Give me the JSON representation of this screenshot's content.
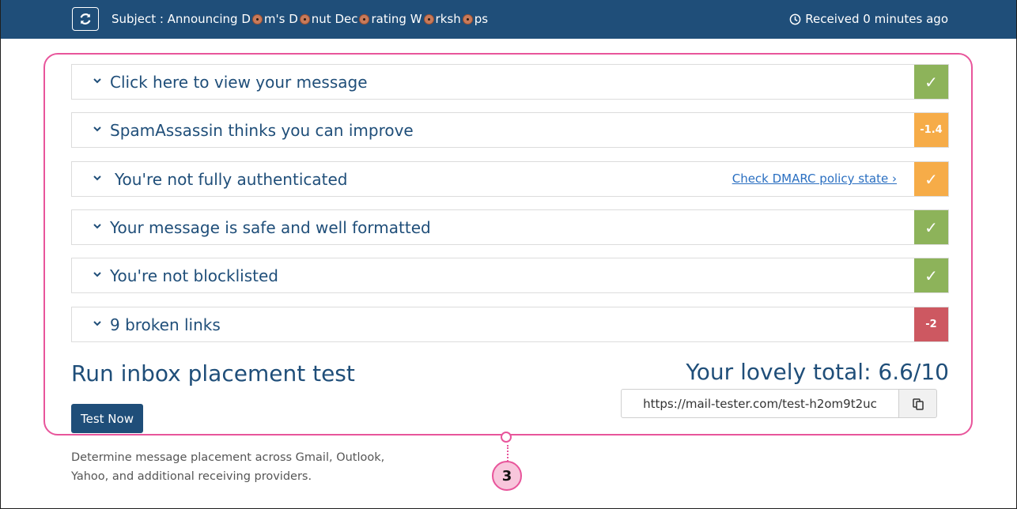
{
  "header": {
    "subject_parts": [
      "Subject : Announcing D",
      "m's D",
      "nut Dec",
      "rating W",
      "rksh",
      "ps"
    ],
    "received": "Received 0 minutes ago"
  },
  "results": [
    {
      "label": "Click here to view your message",
      "badge": "✓",
      "status": "good",
      "status_color": "#8db35a"
    },
    {
      "label": "SpamAssassin thinks you can improve",
      "badge": "-1.4",
      "status": "warning",
      "status_color": "#f6ac48"
    },
    {
      "label": "You're not fully authenticated",
      "badge": "✓",
      "status": "warning",
      "status_color": "#f6ac48",
      "link": "Check DMARC policy state ›"
    },
    {
      "label": "Your message is safe and well formatted",
      "badge": "✓",
      "status": "good",
      "status_color": "#8db35a"
    },
    {
      "label": "You're not blocklisted",
      "badge": "✓",
      "status": "good",
      "status_color": "#8db35a"
    },
    {
      "label": "9 broken links",
      "badge": "-2",
      "status": "bad",
      "status_color": "#cd5861"
    }
  ],
  "placement": {
    "title": "Run inbox placement test",
    "button_label": "Test Now",
    "description": "Determine message placement across Gmail, Outlook, Yahoo, and additional receiving providers."
  },
  "score": {
    "total": "Your lovely total: 6.6/10",
    "url": "https://mail-tester.com/test-h2om9t2uc"
  },
  "callout": {
    "number": "3",
    "color": "#e8559b"
  },
  "colors": {
    "header_bg": "#1f4e79",
    "text_primary": "#1f4e79"
  }
}
